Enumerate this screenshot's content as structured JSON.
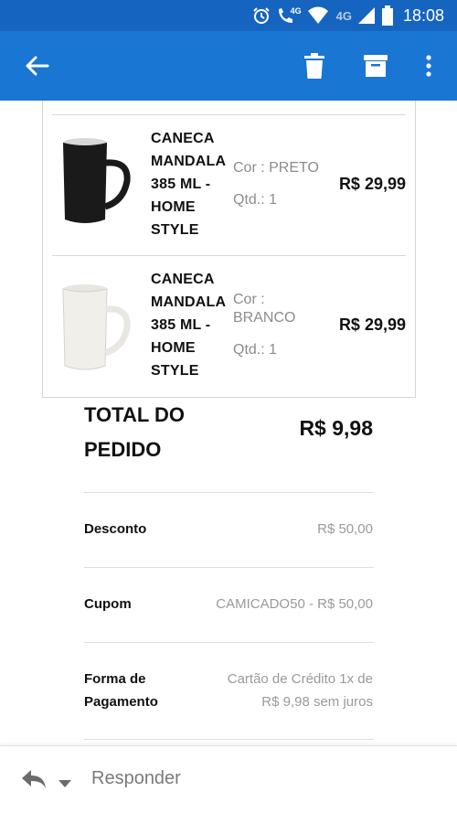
{
  "status_bar": {
    "network_1": "4G",
    "network_2": "4G",
    "time": "18:08"
  },
  "colors": {
    "status_bar": "#1565c0",
    "app_bar": "#1976d2"
  },
  "toolbar": {
    "back_icon": "arrow-left-icon",
    "delete_icon": "trash-icon",
    "archive_icon": "archive-icon",
    "more_icon": "more-vertical-icon"
  },
  "products": [
    {
      "name_lines": [
        "CANECA",
        "MANDALA",
        "385 ML -",
        "HOME",
        "STYLE"
      ],
      "color_label": "Cor : PRETO",
      "qty": "Qtd.: 1",
      "price": "R$ 29,99",
      "image_icon": "black-mug-image"
    },
    {
      "name_lines": [
        "CANECA",
        "MANDALA",
        "385 ML -",
        "HOME",
        "STYLE"
      ],
      "color_label_lines": [
        "Cor :",
        "BRANCO"
      ],
      "qty": "Qtd.: 1",
      "price": "R$ 29,99",
      "image_icon": "white-mug-image"
    }
  ],
  "summary": {
    "total_label_lines": [
      "TOTAL DO",
      "PEDIDO"
    ],
    "total_value": "R$ 9,98",
    "discount_label": "Desconto",
    "discount_value": "R$ 50,00",
    "coupon_label": "Cupom",
    "coupon_value": "CAMICADO50 - R$ 50,00",
    "payment_label_lines": [
      "Forma de",
      "Pagamento"
    ],
    "payment_value_lines": [
      "Cartão de Crédito 1x de",
      "R$ 9,98 sem juros"
    ]
  },
  "reply_bar": {
    "reply_icon": "reply-icon",
    "caret_icon": "caret-down-icon",
    "label": "Responder"
  }
}
